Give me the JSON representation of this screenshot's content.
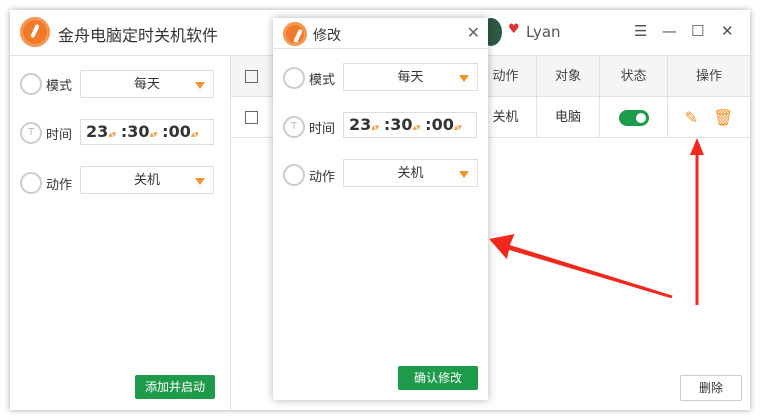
{
  "app": {
    "title": "金舟电脑定时关机软件",
    "user": "Lyan"
  },
  "form": {
    "mode_label": "模式",
    "mode_value": "每天",
    "time_label": "时间",
    "hour": "23",
    "minute": "30",
    "second": "00",
    "action_label": "动作",
    "action_value": "关机",
    "submit": "添加并启动"
  },
  "table": {
    "headers": [
      "动作",
      "对象",
      "状态",
      "操作"
    ],
    "rows": [
      {
        "action": "关机",
        "target": "电脑",
        "enabled": true
      }
    ],
    "delete": "删除"
  },
  "dialog": {
    "title": "修改",
    "mode_label": "模式",
    "mode_value": "每天",
    "time_label": "时间",
    "hour": "23",
    "minute": "30",
    "second": "00",
    "action_label": "动作",
    "action_value": "关机",
    "confirm": "确认修改"
  },
  "colors": {
    "accent": "#f0932b",
    "green": "#1d9b4a",
    "arrow": "#f0281e"
  }
}
